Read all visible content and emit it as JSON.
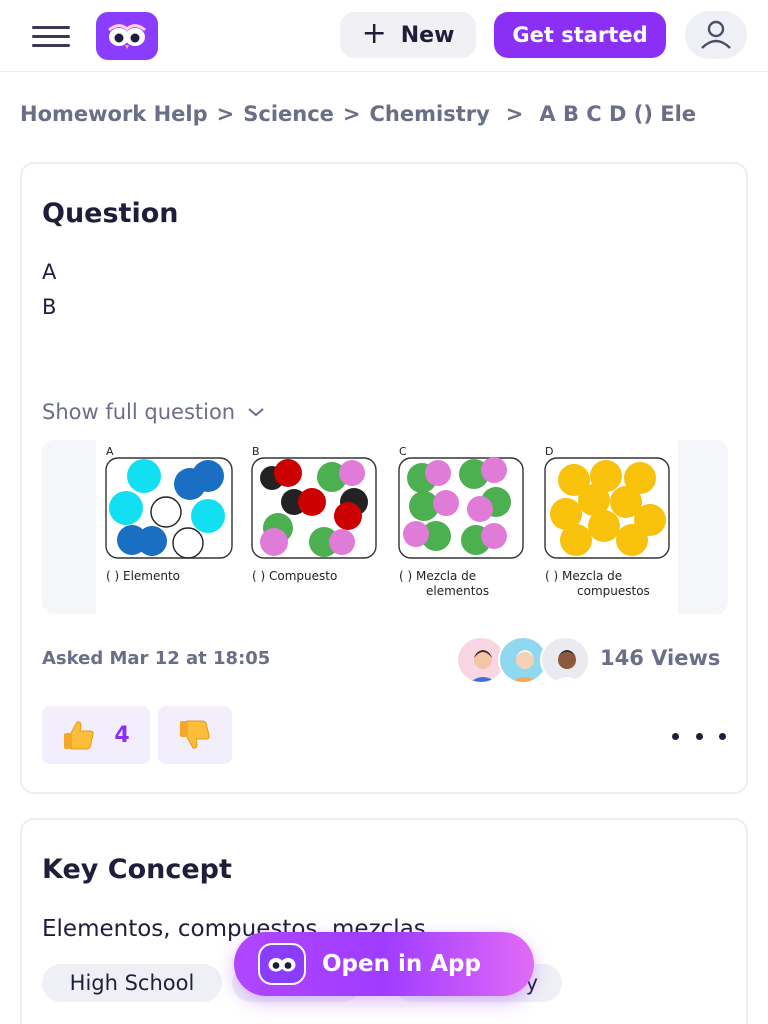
{
  "header": {
    "new_label": "New",
    "get_started_label": "Get started"
  },
  "breadcrumb": {
    "items": [
      "Homework Help",
      "Science",
      "Chemistry",
      "A B C D () Ele"
    ],
    "separator": ">"
  },
  "question": {
    "title": "Question",
    "lines": [
      "A",
      "B"
    ],
    "show_full_label": "Show full question",
    "image": {
      "panels": [
        {
          "letter": "A",
          "caption_line1": "(    ) Elemento",
          "caption_line2": ""
        },
        {
          "letter": "B",
          "caption_line1": "(    ) Compuesto",
          "caption_line2": ""
        },
        {
          "letter": "C",
          "caption_line1": "(    ) Mezcla de",
          "caption_line2": "elementos"
        },
        {
          "letter": "D",
          "caption_line1": "(    ) Mezcla de",
          "caption_line2": "compuestos"
        }
      ]
    },
    "asked": "Asked Mar 12 at 18:05",
    "views": "146 Views",
    "likes": "4"
  },
  "key_concept": {
    "title": "Key Concept",
    "subtitle": "Elementos, compuestos, mezclas",
    "tags": [
      "High School",
      "",
      "ry"
    ]
  },
  "cta": {
    "label": "Open in App"
  },
  "colors": {
    "brand_purple": "#8b2ff5",
    "text_dark": "#1e1e3a",
    "text_muted": "#6a6e86"
  },
  "icons": {
    "menu": "hamburger-menu-icon",
    "logo": "owl-logo-icon",
    "new": "plus-icon",
    "account": "user-icon",
    "show_full": "chevron-down-icon",
    "like": "thumbs-up-icon",
    "dislike": "thumbs-down-icon",
    "more": "more-dots-icon"
  }
}
